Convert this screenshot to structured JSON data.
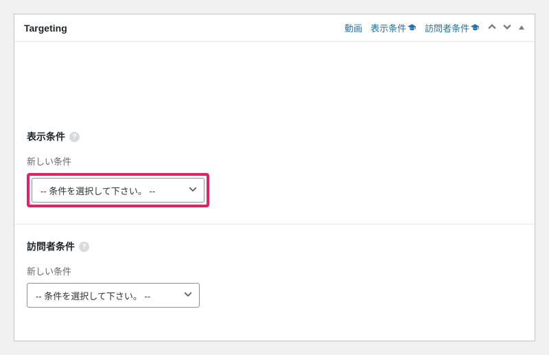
{
  "panel": {
    "title": "Targeting"
  },
  "header_links": {
    "video": "動画",
    "display_conditions": "表示条件",
    "visitor_conditions": "訪問者条件"
  },
  "sections": {
    "display": {
      "title": "表示条件",
      "field_label": "新しい条件",
      "select_placeholder": "-- 条件を選択して下さい。 --"
    },
    "visitor": {
      "title": "訪問者条件",
      "field_label": "新しい条件",
      "select_placeholder": "-- 条件を選択して下さい。 --"
    }
  }
}
